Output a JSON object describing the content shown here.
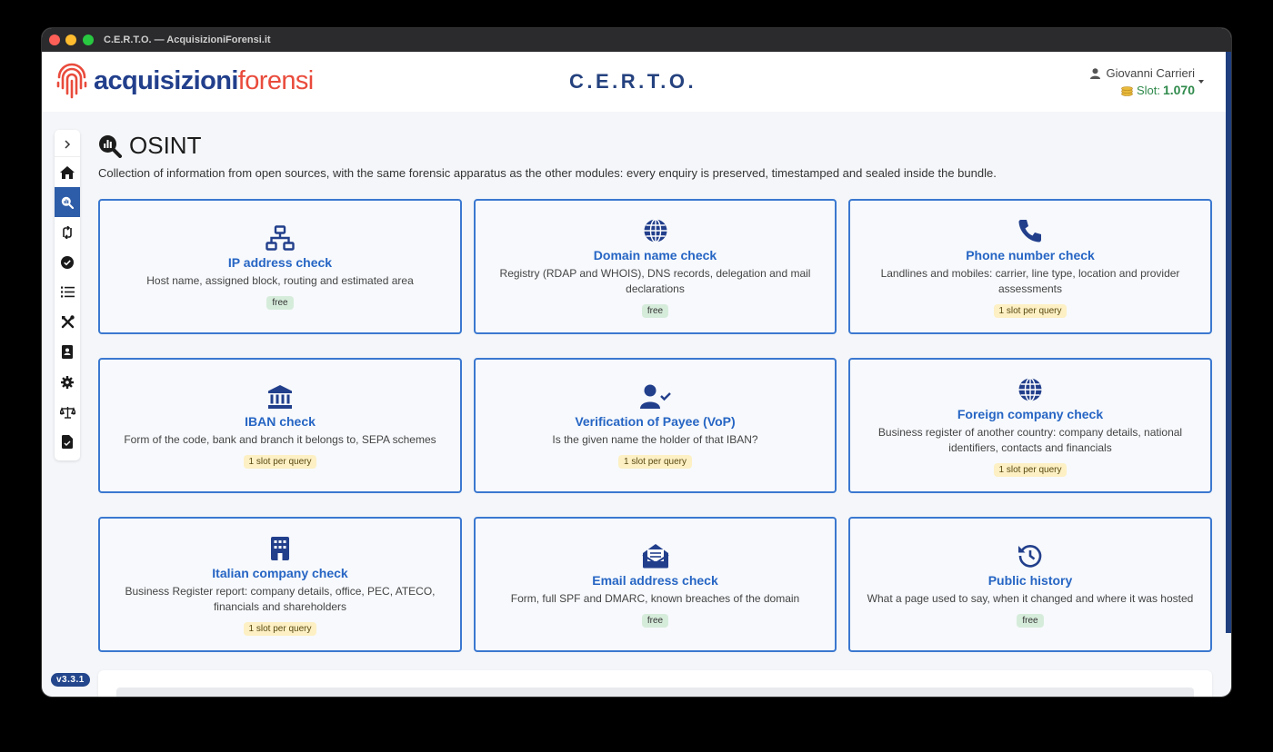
{
  "window": {
    "title": "C.E.R.T.O. — AcquisizioniForensi.it"
  },
  "header": {
    "logo_part1": "acquisizioni",
    "logo_part2": "forensi",
    "brand": "C.E.R.T.O.",
    "user_name": "Giovanni Carrieri",
    "slot_label": "Slot:",
    "slot_value": "1.070"
  },
  "sidebar": {
    "items": [
      {
        "name": "home",
        "icon": "home-icon"
      },
      {
        "name": "osint",
        "icon": "osint-search-icon",
        "active": true
      },
      {
        "name": "transfers",
        "icon": "transfer-icon"
      },
      {
        "name": "verify",
        "icon": "check-circle-icon"
      },
      {
        "name": "list",
        "icon": "list-icon"
      },
      {
        "name": "tools",
        "icon": "tools-icon"
      },
      {
        "name": "contacts",
        "icon": "id-card-icon"
      },
      {
        "name": "settings",
        "icon": "gear-icon"
      },
      {
        "name": "legal",
        "icon": "scale-icon"
      },
      {
        "name": "documents",
        "icon": "document-icon"
      }
    ],
    "version": "v3.3.1"
  },
  "page": {
    "title": "OSINT",
    "description": "Collection of information from open sources, with the same forensic apparatus as the other modules: every enquiry is preserved, timestamped and sealed inside the bundle."
  },
  "cards": [
    {
      "title": "IP address check",
      "desc": "Host name, assigned block, routing and estimated area",
      "badge": "free",
      "icon": "network-icon"
    },
    {
      "title": "Domain name check",
      "desc": "Registry (RDAP and WHOIS), DNS records, delegation and mail declarations",
      "badge": "free",
      "icon": "globe-icon"
    },
    {
      "title": "Phone number check",
      "desc": "Landlines and mobiles: carrier, line type, location and provider assessments",
      "badge": "1 slot per query",
      "icon": "phone-icon"
    },
    {
      "title": "IBAN check",
      "desc": "Form of the code, bank and branch it belongs to, SEPA schemes",
      "badge": "1 slot per query",
      "icon": "bank-icon"
    },
    {
      "title": "Verification of Payee (VoP)",
      "desc": "Is the given name the holder of that IBAN?",
      "badge": "1 slot per query",
      "icon": "user-check-icon"
    },
    {
      "title": "Foreign company check",
      "desc": "Business register of another country: company details, national identifiers, contacts and financials",
      "badge": "1 slot per query",
      "icon": "globe-icon"
    },
    {
      "title": "Italian company check",
      "desc": "Business Register report: company details, office, PEC, ATECO, financials and shareholders",
      "badge": "1 slot per query",
      "icon": "building-icon"
    },
    {
      "title": "Email address check",
      "desc": "Form, full SPF and DMARC, known breaches of the domain",
      "badge": "free",
      "icon": "envelope-icon"
    },
    {
      "title": "Public history",
      "desc": "What a page used to say, when it changed and where it was hosted",
      "badge": "free",
      "icon": "history-icon"
    }
  ],
  "colors": {
    "accent": "#2665c4",
    "brand_blue": "#223f8c",
    "brand_red": "#e94b3c",
    "slot_green": "#2f8a4b"
  }
}
